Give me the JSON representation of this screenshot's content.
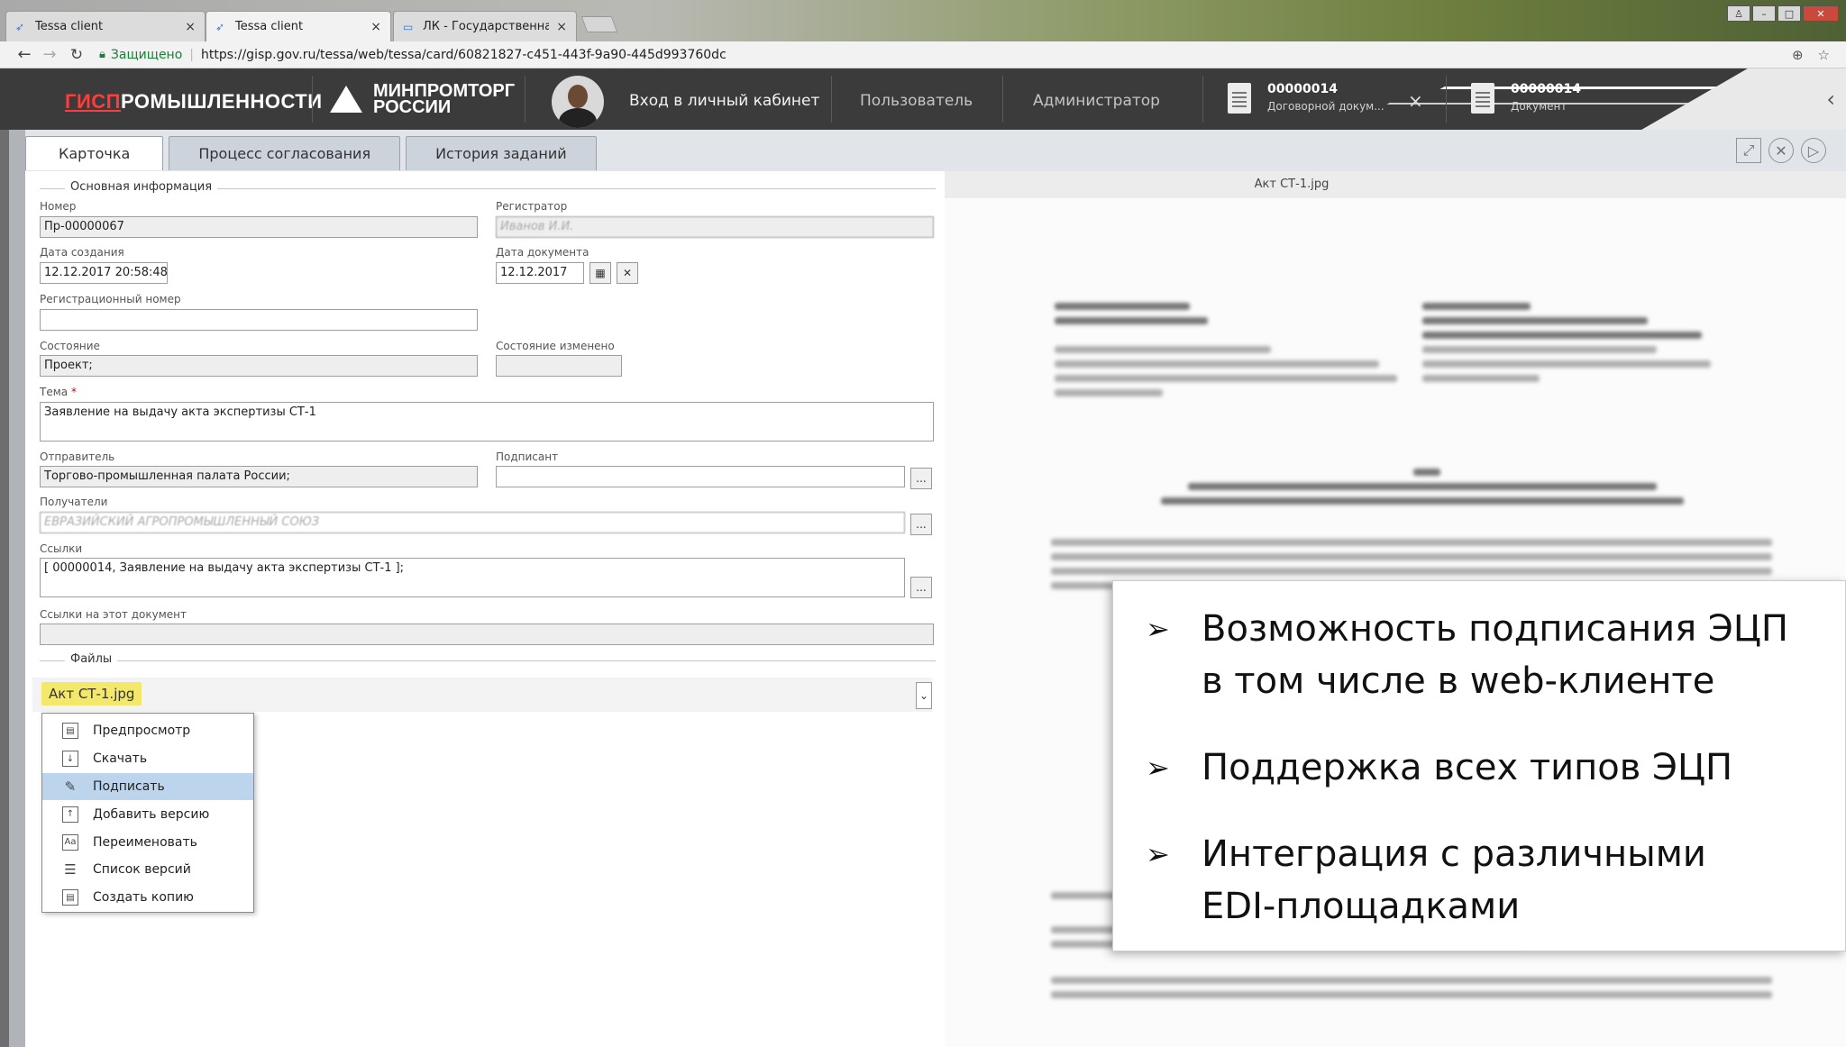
{
  "browser": {
    "tabs": [
      {
        "label": "Tessa client",
        "active": false
      },
      {
        "label": "Tessa client",
        "active": true
      },
      {
        "label": "ЛК - Государственная и",
        "active": false
      }
    ],
    "secure_label": "Защищено",
    "url": "https://gisp.gov.ru/tessa/web/tessa/card/60821827-c451-443f-9a90-445d993760dc"
  },
  "header": {
    "brand_prefix": "ГИСП",
    "brand_suffix": "РОМЫШЛЕННОСТИ",
    "ministry_line1": "МИНПРОМТОРГ",
    "ministry_line2": "РОССИИ",
    "login": "Вход в личный кабинет",
    "user": "Пользователь",
    "admin": "Администратор",
    "docs": [
      {
        "number": "00000014",
        "type": "Договорной докум..."
      },
      {
        "number": "00000014",
        "type": "Документ"
      }
    ]
  },
  "card_tabs": [
    "Карточка",
    "Процесс согласования",
    "История заданий"
  ],
  "form": {
    "section_main": "Основная информация",
    "number_label": "Номер",
    "number_value": "Пр-00000067",
    "registrar_label": "Регистратор",
    "registrar_value": "Иванов И.И.",
    "created_label": "Дата создания",
    "created_value": "12.12.2017 20:58:48",
    "docdate_label": "Дата документа",
    "docdate_value": "12.12.2017",
    "regnum_label": "Регистрационный номер",
    "regnum_value": "",
    "state_label": "Состояние",
    "state_value": "Проект;",
    "state_changed_label": "Состояние изменено",
    "state_changed_value": "",
    "subject_label": "Тема",
    "subject_required": "*",
    "subject_value": "Заявление на выдачу акта экспертизы СТ-1",
    "sender_label": "Отправитель",
    "sender_value": "Торгово-промышленная палата России;",
    "signer_label": "Подписант",
    "signer_value": "",
    "recipients_label": "Получатели",
    "recipients_value": "ЕВРАЗИЙСКИЙ АГРОПРОМЫШЛЕННЫЙ СОЮЗ",
    "links_label": "Ссылки",
    "links_value": "[ 00000014, Заявление на выдачу акта экспертизы СТ-1 ];",
    "backlinks_label": "Ссылки на этот документ",
    "files_section": "Файлы",
    "file_name": "Акт СТ-1.jpg",
    "ellipsis": "..."
  },
  "context_menu": [
    {
      "label": "Предпросмотр",
      "icon": "preview-icon",
      "selected": false
    },
    {
      "label": "Скачать",
      "icon": "download-icon",
      "selected": false
    },
    {
      "label": "Подписать",
      "icon": "sign-pen-icon",
      "selected": true
    },
    {
      "label": "Добавить версию",
      "icon": "add-version-icon",
      "selected": false
    },
    {
      "label": "Переименовать",
      "icon": "rename-icon",
      "selected": false
    },
    {
      "label": "Список версий",
      "icon": "version-list-icon",
      "selected": false
    },
    {
      "label": "Создать копию",
      "icon": "copy-icon",
      "selected": false
    }
  ],
  "preview": {
    "title": "Акт СТ-1.jpg"
  },
  "overlay": {
    "bullets": [
      {
        "line1": "Возможность подписания ЭЦП",
        "line2": "в том числе в web-клиенте"
      },
      {
        "line1": "Поддержка всех типов ЭЦП",
        "line2": ""
      },
      {
        "line1": "Интеграция с различными",
        "line2": "EDI-площадками"
      }
    ]
  },
  "colors": {
    "header_bg": "#3b3b3b",
    "brand_red": "#ff3b3b",
    "menu_selected": "#bcd4ec",
    "file_chip": "#f3e86a"
  }
}
